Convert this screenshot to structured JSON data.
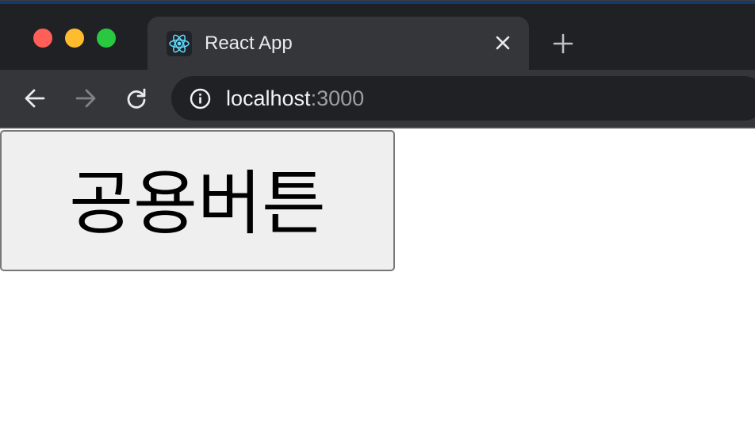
{
  "window": {
    "controls": [
      "close",
      "minimize",
      "zoom"
    ],
    "colors": {
      "close": "#ff5f57",
      "minimize": "#febc2e",
      "zoom": "#28c840"
    }
  },
  "tab": {
    "title": "React App",
    "favicon": "react-logo-icon",
    "close_icon": "close-icon"
  },
  "new_tab_icon": "plus-icon",
  "toolbar": {
    "back_icon": "arrow-left-icon",
    "forward_icon": "arrow-right-icon",
    "reload_icon": "reload-icon",
    "site_info_icon": "info-icon"
  },
  "address_bar": {
    "host": "localhost",
    "port": ":3000"
  },
  "page": {
    "button_label": "공용버튼"
  }
}
